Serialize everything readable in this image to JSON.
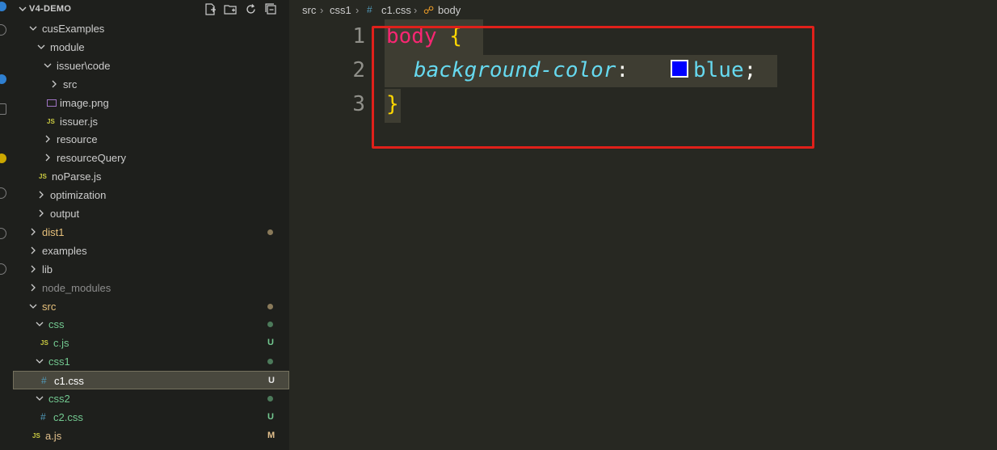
{
  "sidebar": {
    "title": "V4-DEMO",
    "tree": [
      {
        "label": "cusExamples",
        "type": "folder-open",
        "color": "#cccccc"
      },
      {
        "label": "module",
        "type": "folder-open",
        "color": "#cccccc"
      },
      {
        "label": "issuer\\code",
        "type": "folder-open",
        "color": "#cccccc"
      },
      {
        "label": "src",
        "type": "folder-closed",
        "color": "#cccccc"
      },
      {
        "label": "image.png",
        "type": "image-file",
        "color": "#cccccc"
      },
      {
        "label": "issuer.js",
        "type": "js-file",
        "color": "#cccccc"
      },
      {
        "label": "resource",
        "type": "folder-closed",
        "color": "#cccccc"
      },
      {
        "label": "resourceQuery",
        "type": "folder-closed",
        "color": "#cccccc"
      },
      {
        "label": "noParse.js",
        "type": "js-file",
        "color": "#cccccc"
      },
      {
        "label": "optimization",
        "type": "folder-closed",
        "color": "#cccccc"
      },
      {
        "label": "output",
        "type": "folder-closed",
        "color": "#cccccc"
      },
      {
        "label": "dist1",
        "type": "folder-closed",
        "color": "#e6c07b",
        "decoration": "dot",
        "decoration_color": "#8a7a5a"
      },
      {
        "label": "examples",
        "type": "folder-closed",
        "color": "#cccccc"
      },
      {
        "label": "lib",
        "type": "folder-closed",
        "color": "#cccccc"
      },
      {
        "label": "node_modules",
        "type": "folder-closed",
        "color": "#8c8c8c"
      },
      {
        "label": "src",
        "type": "folder-open",
        "color": "#e6c07b",
        "decoration": "dot",
        "decoration_color": "#8a7a5a"
      },
      {
        "label": "css",
        "type": "folder-open",
        "color": "#73c991",
        "decoration": "dot",
        "decoration_color": "#4c7a5a"
      },
      {
        "label": "c.js",
        "type": "js-file",
        "color": "#73c991",
        "decoration": "U",
        "decoration_color": "#73c991"
      },
      {
        "label": "css1",
        "type": "folder-open",
        "color": "#73c991",
        "decoration": "dot",
        "decoration_color": "#4c7a5a"
      },
      {
        "label": "c1.css",
        "type": "css-file",
        "color": "#ffffff",
        "decoration": "U",
        "decoration_color": "#e6e6e6",
        "selected": true
      },
      {
        "label": "css2",
        "type": "folder-open",
        "color": "#73c991",
        "decoration": "dot",
        "decoration_color": "#4c7a5a"
      },
      {
        "label": "c2.css",
        "type": "css-file",
        "color": "#73c991",
        "decoration": "U",
        "decoration_color": "#73c991"
      },
      {
        "label": "a.js",
        "type": "js-file",
        "color": "#e2c08d",
        "decoration": "M",
        "decoration_color": "#e2c08d"
      }
    ]
  },
  "breadcrumb": {
    "items": [
      "src",
      "css1",
      "c1.css",
      "body"
    ]
  },
  "editor": {
    "line_numbers": [
      "1",
      "2",
      "3"
    ],
    "line1": {
      "selector": "body",
      "brace": "{"
    },
    "line2": {
      "property": "background-color",
      "colon": ":",
      "value": "blue",
      "semicolon": ";"
    },
    "line3": {
      "brace": "}"
    }
  },
  "colors": {
    "swatch": "#0000ff",
    "annotation_box": "#e0201a"
  }
}
